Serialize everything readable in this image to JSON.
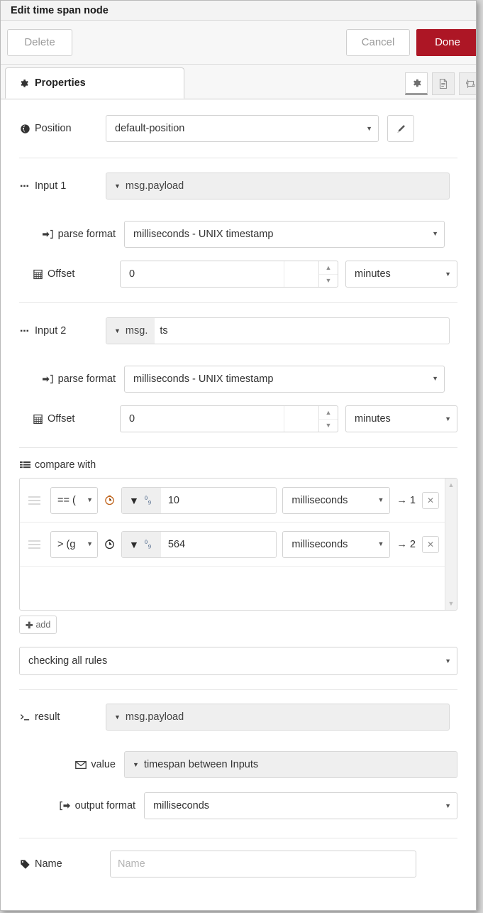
{
  "window": {
    "title": "Edit time span node"
  },
  "toolbar": {
    "delete_label": "Delete",
    "cancel_label": "Cancel",
    "done_label": "Done",
    "done_color": "#ad1625"
  },
  "tabs": {
    "properties_label": "Properties",
    "icons": [
      "gear-icon",
      "description-icon",
      "appearance-icon"
    ]
  },
  "form": {
    "position": {
      "label": "Position",
      "icon": "globe-icon",
      "value": "default-position",
      "edit_icon": "pencil-icon"
    },
    "input1": {
      "label": "Input 1",
      "icon": "ellipsis-icon",
      "prefix": "msg.payload",
      "rest": "",
      "parse_format": {
        "label": "parse format",
        "icon": "sign-in-icon",
        "value": "milliseconds - UNIX timestamp"
      },
      "offset": {
        "label": "Offset",
        "icon": "calculator-icon",
        "value": "0",
        "unit": "minutes"
      }
    },
    "input2": {
      "label": "Input 2",
      "icon": "ellipsis-icon",
      "prefix": "msg.",
      "rest": "ts",
      "parse_format": {
        "label": "parse format",
        "icon": "sign-in-icon",
        "value": "milliseconds - UNIX timestamp"
      },
      "offset": {
        "label": "Offset",
        "icon": "calculator-icon",
        "value": "0",
        "unit": "minutes"
      }
    },
    "compare": {
      "label": "compare with",
      "icon": "list-icon",
      "rules": [
        {
          "operator": "== (",
          "time_icon": "clock-icon",
          "type_icon": "number-icon",
          "value": "10",
          "unit": "milliseconds",
          "output": "→ 1",
          "remove": "✕"
        },
        {
          "operator": "> (g",
          "time_icon": "clock-icon",
          "type_icon": "number-icon",
          "value": "564",
          "unit": "milliseconds",
          "output": "→ 2",
          "remove": "✕"
        }
      ],
      "add_label": "add",
      "mode": "checking all rules"
    },
    "result": {
      "label": "result",
      "icon": "terminal-icon",
      "prefix": "msg.payload",
      "value_row": {
        "label": "value",
        "icon": "envelope-icon",
        "value": "timespan between Inputs"
      },
      "output_format": {
        "label": "output format",
        "icon": "sign-out-icon",
        "value": "milliseconds"
      }
    },
    "name": {
      "label": "Name",
      "icon": "tag-icon",
      "value": "",
      "placeholder": "Name"
    }
  }
}
